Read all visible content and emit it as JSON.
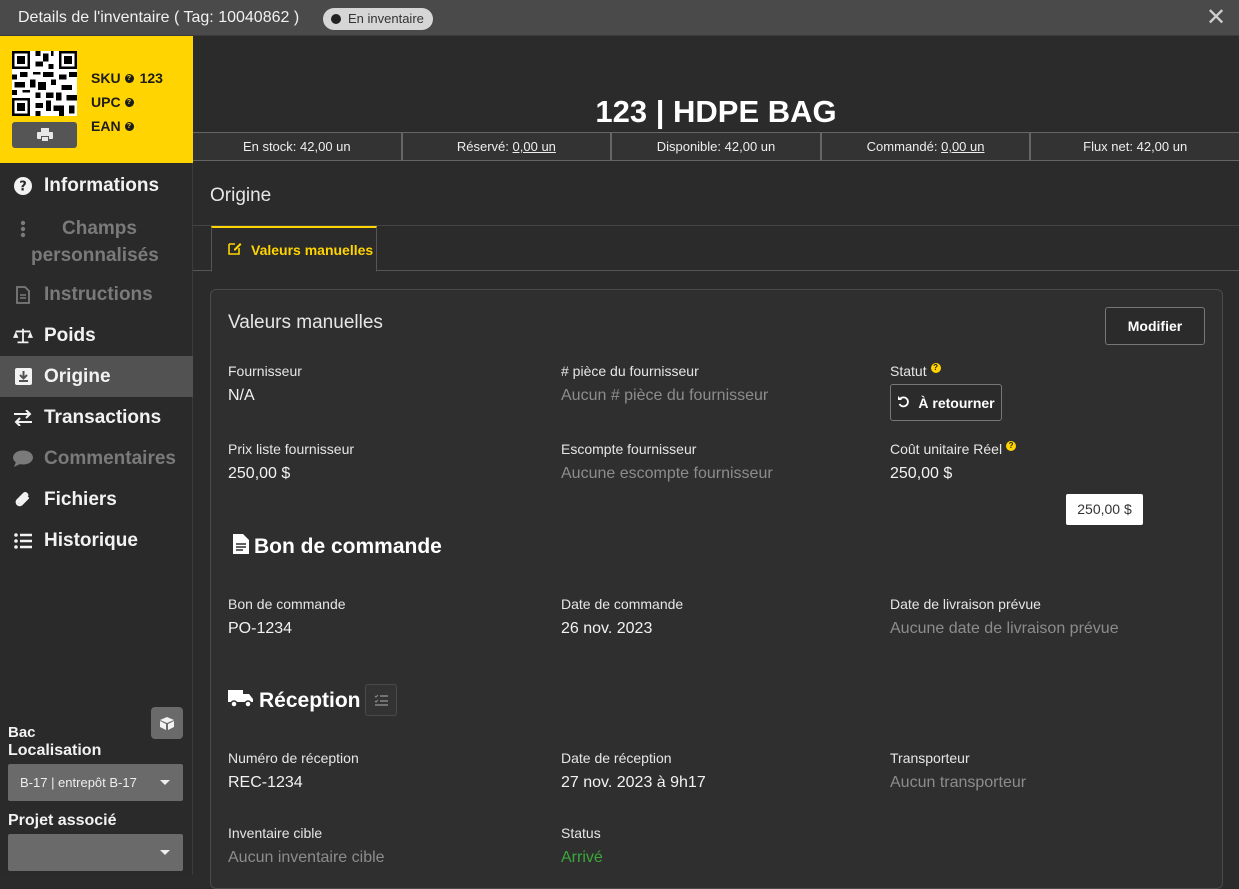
{
  "titlebar": {
    "title": "Details de l'inventaire ( Tag: 10040862 )",
    "status_badge": "En inventaire",
    "close_icon": "close-icon"
  },
  "identity": {
    "codes": [
      {
        "label": "SKU",
        "value": "123"
      },
      {
        "label": "UPC",
        "value": ""
      },
      {
        "label": "EAN",
        "value": ""
      }
    ],
    "accent_color": "#ffd400"
  },
  "sidebar": {
    "items": [
      {
        "label": "Informations",
        "icon": "question-circle-icon"
      },
      {
        "label": "Champs personnalisés",
        "icon": "vertical-ellipsis-icon"
      },
      {
        "label": "Instructions",
        "icon": "document-icon"
      },
      {
        "label": "Poids",
        "icon": "balance-scale-icon"
      },
      {
        "label": "Origine",
        "icon": "download-box-icon"
      },
      {
        "label": "Transactions",
        "icon": "exchange-arrows-icon"
      },
      {
        "label": "Commentaires",
        "icon": "comment-icon"
      },
      {
        "label": "Fichiers",
        "icon": "paperclip-icon"
      },
      {
        "label": "Historique",
        "icon": "list-icon"
      }
    ],
    "bac_label": "Bac",
    "localisation_label": "Localisation",
    "localisation_value": "B-17 | entrepôt B-17",
    "projet_label": "Projet associé",
    "projet_value": ""
  },
  "header": {
    "product": "123 | HDPE BAG"
  },
  "stats": {
    "en_stock_label": "En stock:",
    "en_stock_value": "42,00 un",
    "reserve_label": "Réservé:",
    "reserve_value": "0,00 un",
    "disponible_label": "Disponible:",
    "disponible_value": "42,00 un",
    "commande_label": "Commandé:",
    "commande_value": "0,00 un",
    "flux_label": "Flux net:",
    "flux_value": "42,00 un"
  },
  "origine": {
    "section_title": "Origine",
    "tab_label": "Valeurs manuelles",
    "card_title": "Valeurs manuelles",
    "modify_button": "Modifier",
    "fournisseur_label": "Fournisseur",
    "fournisseur_value": "N/A",
    "piece_label": "# pièce du fournisseur",
    "piece_value": "Aucun # pièce du fournisseur",
    "statut_label": "Statut",
    "statut_button": "À retourner",
    "prix_label": "Prix liste fournisseur",
    "prix_value": "250,00 $",
    "escompte_label": "Escompte fournisseur",
    "escompte_value": "Aucune escompte fournisseur",
    "cout_label": "Coût unitaire Réel",
    "cout_value": "250,00 $",
    "cout_tooltip": "250,00 $",
    "bon_heading": "Bon de commande",
    "bon_label": "Bon de commande",
    "bon_value": "PO-1234",
    "date_cmd_label": "Date de commande",
    "date_cmd_value": "26 nov. 2023",
    "date_liv_label": "Date de livraison prévue",
    "date_liv_value": "Aucune date de livraison prévue",
    "reception_heading": "Réception",
    "num_rec_label": "Numéro de réception",
    "num_rec_value": "REC-1234",
    "date_rec_label": "Date de réception",
    "date_rec_value": "27 nov. 2023 à 9h17",
    "transporteur_label": "Transporteur",
    "transporteur_value": "Aucun transporteur",
    "inv_cible_label": "Inventaire cible",
    "inv_cible_value": "Aucun inventaire cible",
    "status_label": "Status",
    "status_value": "Arrivé",
    "status_color": "#3aa83a"
  }
}
